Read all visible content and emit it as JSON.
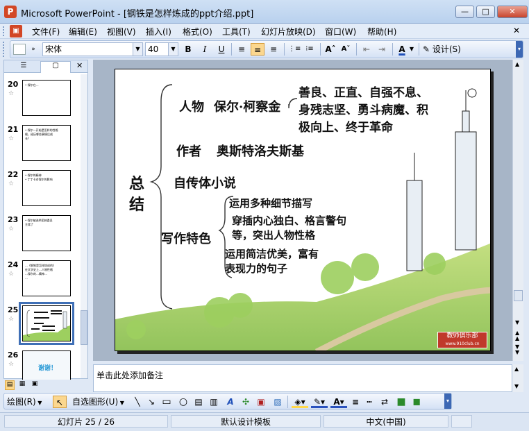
{
  "window": {
    "title": "Microsoft PowerPoint - [钢铁是怎样炼成的ppt介绍.ppt]",
    "app_icon": "P",
    "min": "—",
    "max": "□",
    "close": "✕"
  },
  "menu": [
    "文件(F)",
    "编辑(E)",
    "视图(V)",
    "插入(I)",
    "格式(O)",
    "工具(T)",
    "幻灯片放映(D)",
    "窗口(W)",
    "帮助(H)"
  ],
  "menu_close": "✕",
  "format_toolbar": {
    "font_name": "宋体",
    "font_size": "40",
    "bold": "B",
    "italic": "I",
    "underline": "U",
    "design_label": "设计(S)",
    "font_color_letter": "A"
  },
  "slides": [
    {
      "num": "20",
      "lines": [
        "• 保尔在…"
      ]
    },
    {
      "num": "21",
      "lines": [
        "• 保尔一开始是怎样的性格",
        "  格，经历哪些事情后成",
        "  长？"
      ]
    },
    {
      "num": "22",
      "lines": [
        "• 保尔的精神",
        "• 丁丁卡对保尔的影响"
      ]
    },
    {
      "num": "23",
      "lines": [
        "• 保尔被选举团体委员",
        "  主席了"
      ]
    },
    {
      "num": "24",
      "lines": [
        "…《钢铁是怎样炼成的》",
        "在文学史上…人物性格",
        "…保尔的…精神…",
        "…"
      ]
    },
    {
      "num": "25",
      "lines": []
    },
    {
      "num": "26",
      "lines": [
        "谢谢！"
      ]
    }
  ],
  "slide": {
    "side_title": [
      "总",
      "结"
    ],
    "person_label": "人物",
    "person_name": "保尔·柯察金",
    "traits": [
      "善良、正直、自强不息、",
      "身残志坚、勇斗病魔、积",
      "极向上、终于革命"
    ],
    "author_label": "作者",
    "author_name": "奥斯特洛夫斯基",
    "genre": "自传体小说",
    "style_label": "写作特色",
    "style_items": [
      "运用多种细节描写",
      "穿插内心独白、格言警句",
      "等，突出人物性格",
      "运用简洁优美，富有",
      "表现力的句子"
    ],
    "watermark": "教师俱乐部",
    "watermark_url": "www.910club.cn"
  },
  "notes_placeholder": "单击此处添加备注",
  "draw_toolbar": {
    "draw_label": "绘图(R)",
    "autoshape_label": "自选图形(U)"
  },
  "status": {
    "slide_pos": "幻灯片 25 / 26",
    "template": "默认设计模板",
    "language": "中文(中国)"
  }
}
